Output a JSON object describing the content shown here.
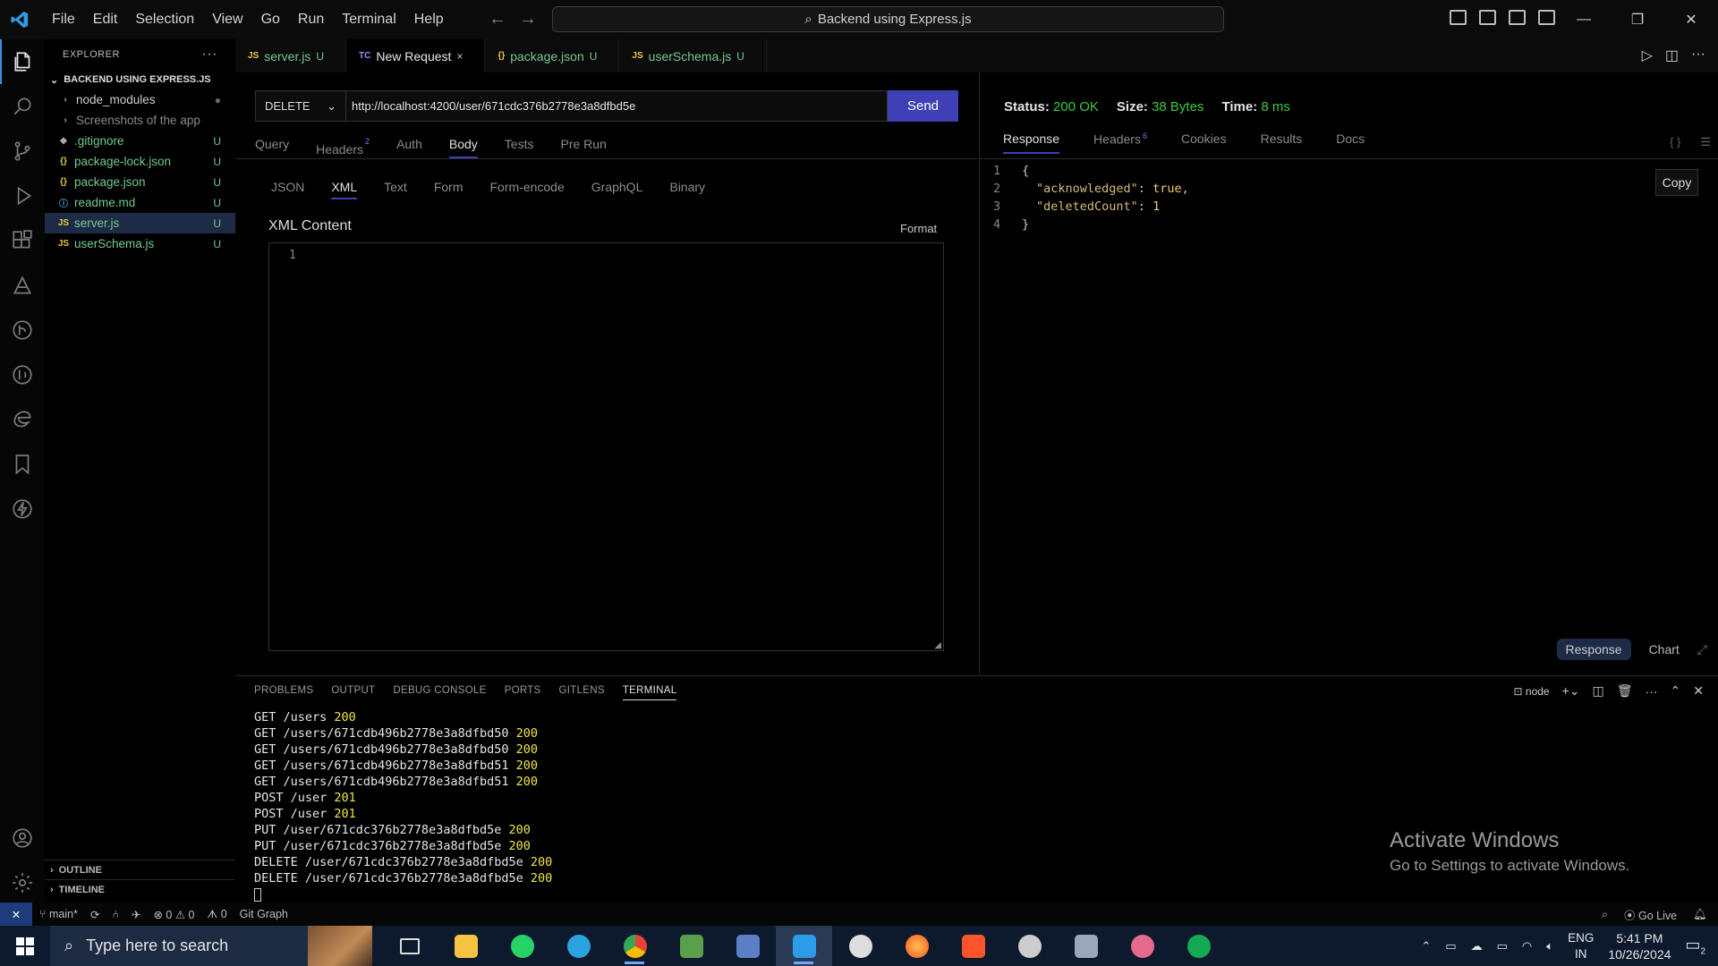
{
  "titlebar": {
    "menu": [
      "File",
      "Edit",
      "Selection",
      "View",
      "Go",
      "Run",
      "Terminal",
      "Help"
    ],
    "search_text": "Backend using Express.js"
  },
  "explorer": {
    "header": "EXPLORER",
    "root": "BACKEND USING EXPRESS.JS",
    "items": [
      {
        "icon": "›",
        "label": "node_modules",
        "status": "●",
        "color": "#cccccc"
      },
      {
        "icon": "›",
        "label": "Screenshots of the app",
        "status": "",
        "color": "#8a8a8a"
      },
      {
        "icon": "◆",
        "label": ".gitignore",
        "status": "U",
        "color": "#73c991"
      },
      {
        "icon": "{}",
        "label": "package-lock.json",
        "status": "U",
        "color": "#73c991"
      },
      {
        "icon": "{}",
        "label": "package.json",
        "status": "U",
        "color": "#73c991"
      },
      {
        "icon": "ⓘ",
        "label": "readme.md",
        "status": "U",
        "color": "#73c991"
      },
      {
        "icon": "JS",
        "label": "server.js",
        "status": "U",
        "color": "#73c991"
      },
      {
        "icon": "JS",
        "label": "userSchema.js",
        "status": "U",
        "color": "#73c991"
      }
    ],
    "outline": "OUTLINE",
    "timeline": "TIMELINE"
  },
  "tabs": [
    {
      "icon": "JS",
      "label": "server.js",
      "status": "U",
      "active": false
    },
    {
      "icon": "TC",
      "label": "New Request",
      "status": "×",
      "active": true
    },
    {
      "icon": "{}",
      "label": "package.json",
      "status": "U",
      "active": false
    },
    {
      "icon": "JS",
      "label": "userSchema.js",
      "status": "U",
      "active": false
    }
  ],
  "request": {
    "method": "DELETE",
    "url": "http://localhost:4200/user/671cdc376b2778e3a8dfbd5e",
    "send_label": "Send",
    "subtabs": [
      "Query",
      "Headers",
      "Auth",
      "Body",
      "Tests",
      "Pre Run"
    ],
    "headers_count": "2",
    "bodytabs": [
      "JSON",
      "XML",
      "Text",
      "Form",
      "Form-encode",
      "GraphQL",
      "Binary"
    ],
    "xml_title": "XML Content",
    "format_label": "Format",
    "line_number": "1"
  },
  "response": {
    "status_label": "Status:",
    "status_value": "200 OK",
    "size_label": "Size:",
    "size_value": "38 Bytes",
    "time_label": "Time:",
    "time_value": "8 ms",
    "tabs": [
      "Response",
      "Headers",
      "Cookies",
      "Results",
      "Docs"
    ],
    "headers_count": "6",
    "code_lines": [
      "1",
      "2",
      "3",
      "4"
    ],
    "open_brace": "{",
    "key1": "\"acknowledged\"",
    "val1": "true",
    "key2": "\"deletedCount\"",
    "val2": "1",
    "close_brace": "}",
    "copy_label": "Copy",
    "bottom_response": "Response",
    "bottom_chart": "Chart"
  },
  "panel": {
    "tabs": [
      "PROBLEMS",
      "OUTPUT",
      "DEBUG CONSOLE",
      "PORTS",
      "GITLENS",
      "TERMINAL"
    ],
    "terminal_name": "node",
    "lines": [
      {
        "t": "GET /users ",
        "c": "200"
      },
      {
        "t": "GET /users/671cdb496b2778e3a8dfbd50 ",
        "c": "200"
      },
      {
        "t": "GET /users/671cdb496b2778e3a8dfbd50 ",
        "c": "200"
      },
      {
        "t": "GET /users/671cdb496b2778e3a8dfbd51 ",
        "c": "200"
      },
      {
        "t": "GET /users/671cdb496b2778e3a8dfbd51 ",
        "c": "200"
      },
      {
        "t": "POST /user ",
        "c": "201"
      },
      {
        "t": "POST /user ",
        "c": "201"
      },
      {
        "t": "PUT /user/671cdc376b2778e3a8dfbd5e ",
        "c": "200"
      },
      {
        "t": "PUT /user/671cdc376b2778e3a8dfbd5e ",
        "c": "200"
      },
      {
        "t": "DELETE /user/671cdc376b2778e3a8dfbd5e ",
        "c": "200"
      },
      {
        "t": "DELETE /user/671cdc376b2778e3a8dfbd5e ",
        "c": "200"
      }
    ]
  },
  "watermark": {
    "title": "Activate Windows",
    "sub": "Go to Settings to activate Windows."
  },
  "statusbar": {
    "branch": "main*",
    "errors": "0",
    "warnings": "0",
    "ports": "0",
    "git_graph": "Git Graph",
    "go_live": "Go Live"
  },
  "taskbar": {
    "search_placeholder": "Type here to search",
    "lang1": "ENG",
    "lang2": "IN",
    "time": "5:41 PM",
    "date": "10/26/2024",
    "notif_count": "2"
  },
  "colors": {
    "accent": "#3f3fb6",
    "success": "#3ec93e",
    "status_yellow": "#f0e44a",
    "git_untracked": "#73c991"
  }
}
